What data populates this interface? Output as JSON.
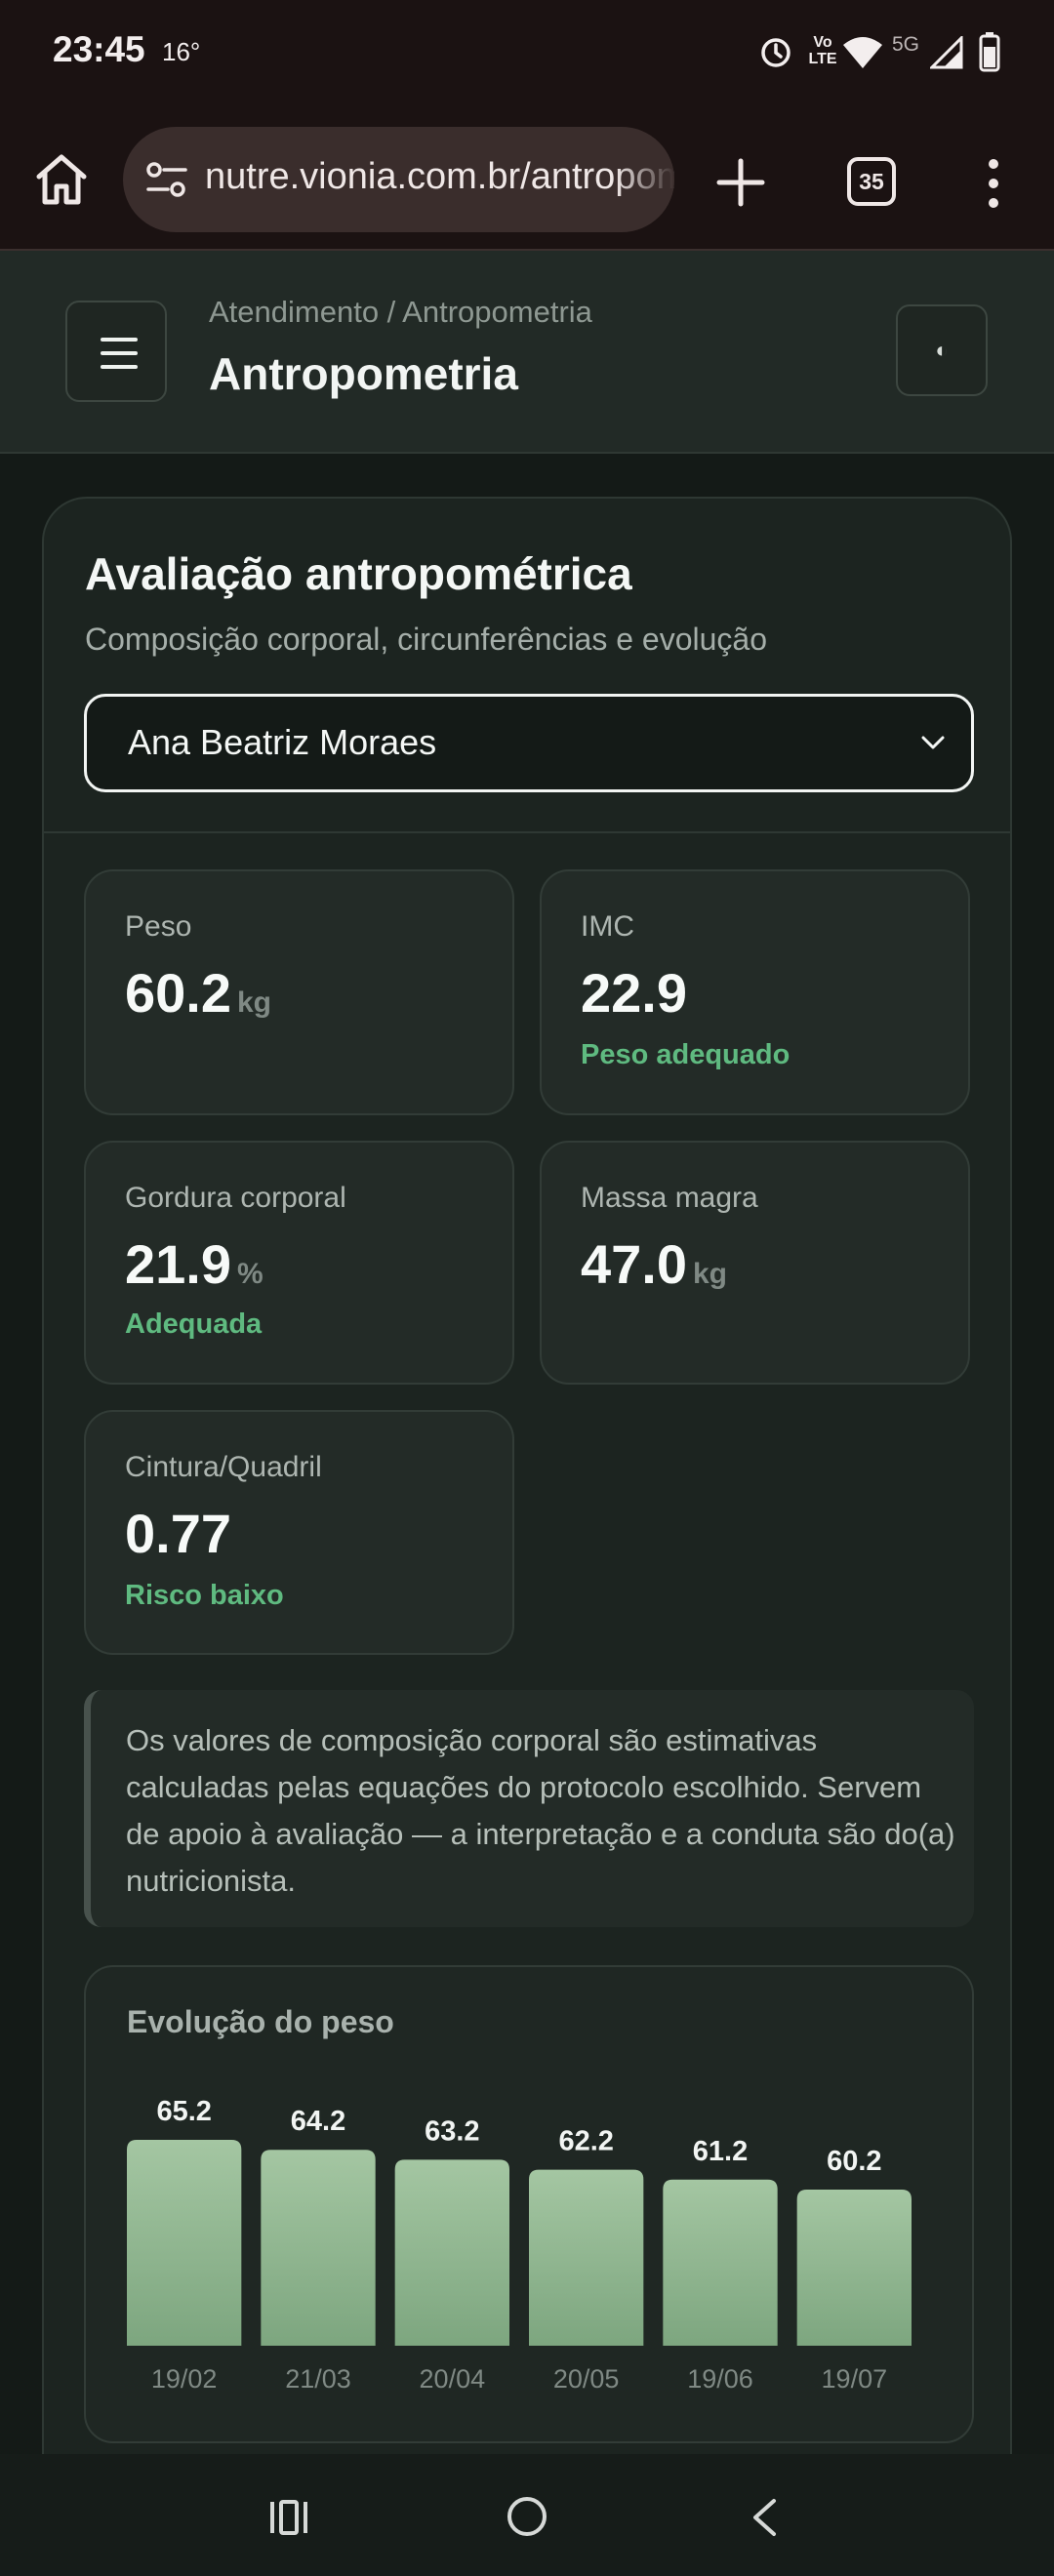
{
  "status_bar": {
    "time": "23:45",
    "temperature": "16°",
    "network": "5G",
    "volte_label_top": "Vo",
    "volte_label_bottom": "LTE",
    "icons": [
      "alarm-icon",
      "volte-icon",
      "wifi-icon",
      "signal-icon",
      "battery-icon"
    ]
  },
  "browser": {
    "url": "nutre.vionia.com.br/antropometria",
    "tab_count": "35",
    "icons": [
      "home-icon",
      "site-settings-icon",
      "new-tab-plus-icon",
      "tab-switcher-icon",
      "more-menu-icon"
    ]
  },
  "header": {
    "breadcrumb": "Atendimento / Antropometria",
    "title": "Antropometria",
    "theme_toggle_icon": "◐"
  },
  "card": {
    "title": "Avaliação antropométrica",
    "subtitle": "Composição corporal, circunferências e evolução",
    "patient_select": {
      "selected": "Ana Beatriz Moraes"
    }
  },
  "metrics": {
    "peso": {
      "label": "Peso",
      "value": "60.2",
      "unit": "kg"
    },
    "imc": {
      "label": "IMC",
      "value": "22.9",
      "status": "Peso adequado"
    },
    "gordura": {
      "label": "Gordura corporal",
      "value": "21.9",
      "unit": "%",
      "status": "Adequada"
    },
    "massa": {
      "label": "Massa magra",
      "value": "47.0",
      "unit": "kg"
    },
    "cintura": {
      "label": "Cintura/Quadril",
      "value": "0.77",
      "status": "Risco baixo"
    }
  },
  "note": {
    "text": "Os valores de composição corporal são estimativas calculadas pelas equações do protocolo escolhido. Servem de apoio à avaliação — a interpretação e a conduta são do(a) nutricionista."
  },
  "colors": {
    "accent_green": "#5fba80",
    "bar_top": "#a4c6a2",
    "bar_bottom": "#7da67f",
    "background": "#141a17"
  },
  "chart_data": {
    "type": "bar",
    "title": "Evolução do peso",
    "categories": [
      "19/02",
      "21/03",
      "20/04",
      "20/05",
      "19/06",
      "19/07"
    ],
    "values": [
      65.2,
      64.2,
      63.2,
      62.2,
      61.2,
      60.2
    ],
    "data_labels": [
      "65.2",
      "64.2",
      "63.2",
      "62.2",
      "61.2",
      "60.2"
    ],
    "grid": false,
    "legend": "none"
  },
  "nav_bar": {
    "icons": [
      "recents-icon",
      "home-circle-icon",
      "back-icon"
    ]
  }
}
